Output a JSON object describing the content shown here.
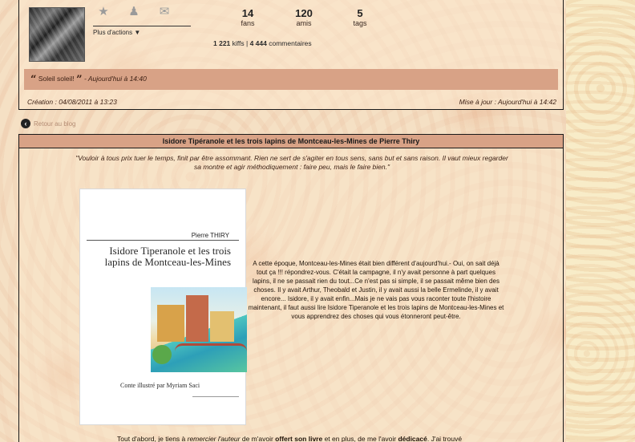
{
  "profile": {
    "actions": {
      "favorite_icon": "star-plus-icon",
      "add_friend_icon": "user-plus-icon",
      "message_icon": "envelope-icon",
      "more_label": "Plus d'actions ▼"
    },
    "stats": [
      {
        "value": "14",
        "label": "fans"
      },
      {
        "value": "120",
        "label": "amis"
      },
      {
        "value": "5",
        "label": "tags"
      }
    ],
    "counts": {
      "kiffs_value": "1 221",
      "kiffs_label": "kiffs",
      "separator": "|",
      "comments_value": "4 444",
      "comments_label": "commentaires"
    },
    "status": {
      "open_quote": "“",
      "text": "Soleil soleil!",
      "close_quote": "”",
      "timestamp": "- Aujourd'hui à 14:40"
    },
    "created": "Création : 04/08/2011 à 13:23",
    "updated": "Mise à jour : Aujourd'hui à 14:42"
  },
  "nav": {
    "back_label": "Retour au blog"
  },
  "article": {
    "title": "Isidore Tipéranole et les trois lapins de Montceau-les-Mines de Pierre Thiry",
    "quote": "\"Vouloir à tous prix tuer le temps, finit par être assommant. Rien ne sert de s'agiter en tous sens, sans but et sans raison. Il vaut mieux regarder sa montre et agir méthodiquement : faire peu, mais le faire bien.\"",
    "cover": {
      "author": "Pierre THIRY",
      "title": "Isidore Tiperanole et les trois lapins de Montceau-les-Mines",
      "subtitle": "Conte illustré par Myriam Saci"
    },
    "synopsis": "A cette époque, Montceau-les-Mines était bien différent d'aujourd'hui.- Oui, on sait déjà tout ça !!! répondrez-vous. C'était la campagne, il n'y avait personne à part quelques lapins, il ne se passait rien du tout...Ce n'est pas si simple, il se passait même bien des choses. Il y avait Arthur, Theobald et Justin, il y avait aussi la belle Ermelinde, il y avait encore... Isidore, il y avait enfin...Mais je ne vais pas vous raconter toute l'histoire maintenant, il faut aussi lire Isidore Tiperanole et les trois lapins de Montceau-les-Mines et vous apprendrez des choses qui vous étonneront peut-être.",
    "bottom": {
      "part1": "Tout d'abord, je tiens à ",
      "link": "remercier l'auteur",
      "part2": " de m'avoir ",
      "bold1": "offert son livre",
      "part3": " et en plus, de me l'avoir ",
      "bold2": "dédicacé",
      "part4": ". J'ai trouvé"
    }
  },
  "colors": {
    "bar": "#d8a286",
    "border": "#1a1a1a",
    "background": "#f5e0c4"
  }
}
